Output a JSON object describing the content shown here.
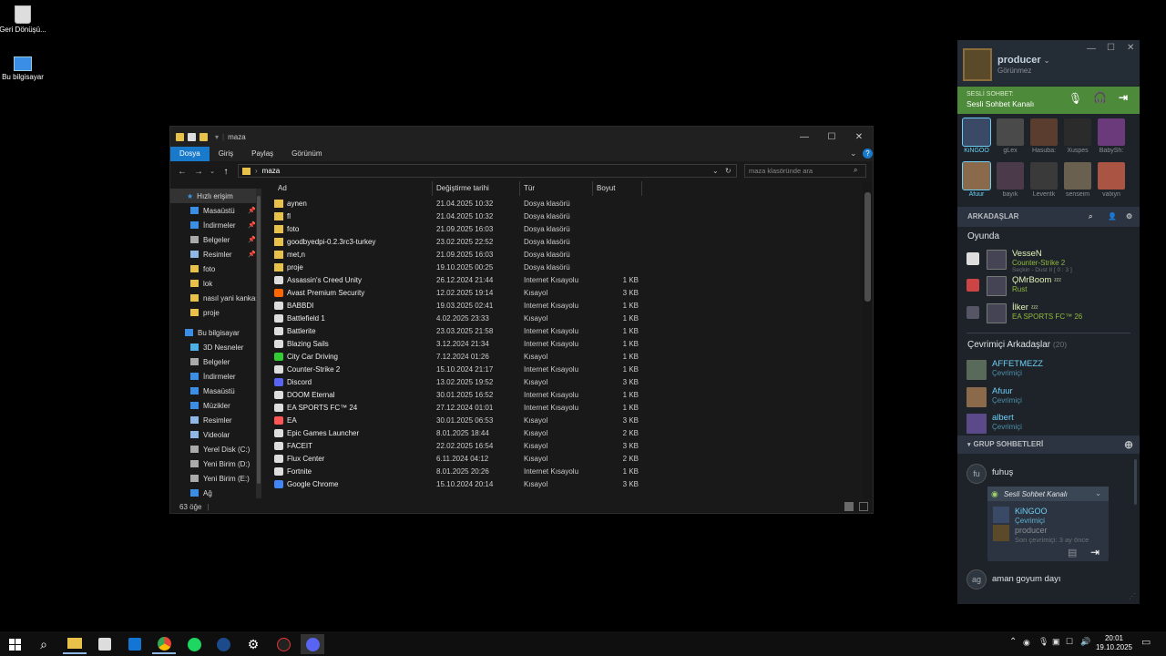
{
  "desktop": {
    "icons": [
      {
        "label": "Geri Dönüşü..."
      },
      {
        "label": "Bu bilgisayar"
      }
    ]
  },
  "explorer": {
    "title": "maza",
    "ribbon_tabs": [
      "Dosya",
      "Giriş",
      "Paylaş",
      "Görünüm"
    ],
    "address_path": "maza",
    "search_placeholder": "maza klasöründe ara",
    "nav": {
      "quick_access": "Hızlı erişim",
      "quick_items": [
        "Masaüstü",
        "İndirmeler",
        "Belgeler",
        "Resimler",
        "foto",
        "lok",
        "nasıl yani kankas",
        "proje"
      ],
      "this_pc": "Bu bilgisayar",
      "pc_items": [
        "3D Nesneler",
        "Belgeler",
        "İndirmeler",
        "Masaüstü",
        "Müzikler",
        "Resimler",
        "Videolar",
        "Yerel Disk (C:)",
        "Yeni Birim (D:)",
        "Yeni Birim (E:)",
        "Ağ"
      ]
    },
    "columns": {
      "name": "Ad",
      "date": "Değiştirme tarihi",
      "type": "Tür",
      "size": "Boyut"
    },
    "files": [
      {
        "name": "aynen",
        "date": "21.04.2025 10:32",
        "type": "Dosya klasörü",
        "size": "",
        "icon": "folder"
      },
      {
        "name": "fl",
        "date": "21.04.2025 10:32",
        "type": "Dosya klasörü",
        "size": "",
        "icon": "folder"
      },
      {
        "name": "foto",
        "date": "21.09.2025 16:03",
        "type": "Dosya klasörü",
        "size": "",
        "icon": "folder"
      },
      {
        "name": "goodbyedpi-0.2.3rc3-turkey",
        "date": "23.02.2025 22:52",
        "type": "Dosya klasörü",
        "size": "",
        "icon": "folder"
      },
      {
        "name": "met,n",
        "date": "21.09.2025 16:03",
        "type": "Dosya klasörü",
        "size": "",
        "icon": "folder"
      },
      {
        "name": "proje",
        "date": "19.10.2025 00:25",
        "type": "Dosya klasörü",
        "size": "",
        "icon": "folder"
      },
      {
        "name": "Assassin's Creed Unity",
        "date": "26.12.2024 21:44",
        "type": "Internet Kısayolu",
        "size": "1 KB",
        "icon": "shortcut"
      },
      {
        "name": "Avast Premium Security",
        "date": "12.02.2025 19:14",
        "type": "Kısayol",
        "size": "3 KB",
        "icon": "avast"
      },
      {
        "name": "BABBDI",
        "date": "19.03.2025 02:41",
        "type": "Internet Kısayolu",
        "size": "1 KB",
        "icon": "shortcut"
      },
      {
        "name": "Battlefield 1",
        "date": "4.02.2025 23:33",
        "type": "Kısayol",
        "size": "1 KB",
        "icon": "shortcut"
      },
      {
        "name": "Battlerite",
        "date": "23.03.2025 21:58",
        "type": "Internet Kısayolu",
        "size": "1 KB",
        "icon": "shortcut"
      },
      {
        "name": "Blazing Sails",
        "date": "3.12.2024 21:34",
        "type": "Internet Kısayolu",
        "size": "1 KB",
        "icon": "shortcut"
      },
      {
        "name": "City Car Driving",
        "date": "7.12.2024 01:26",
        "type": "Kısayol",
        "size": "1 KB",
        "icon": "green"
      },
      {
        "name": "Counter-Strike 2",
        "date": "15.10.2024 21:17",
        "type": "Internet Kısayolu",
        "size": "1 KB",
        "icon": "shortcut"
      },
      {
        "name": "Discord",
        "date": "13.02.2025 19:52",
        "type": "Kısayol",
        "size": "3 KB",
        "icon": "discord"
      },
      {
        "name": "DOOM Eternal",
        "date": "30.01.2025 16:52",
        "type": "Internet Kısayolu",
        "size": "1 KB",
        "icon": "shortcut"
      },
      {
        "name": "EA SPORTS FC™ 24",
        "date": "27.12.2024 01:01",
        "type": "Internet Kısayolu",
        "size": "1 KB",
        "icon": "shortcut"
      },
      {
        "name": "EA",
        "date": "30.01.2025 06:53",
        "type": "Kısayol",
        "size": "3 KB",
        "icon": "ea"
      },
      {
        "name": "Epic Games Launcher",
        "date": "8.01.2025 18:44",
        "type": "Kısayol",
        "size": "2 KB",
        "icon": "shortcut"
      },
      {
        "name": "FACEIT",
        "date": "22.02.2025 16:54",
        "type": "Kısayol",
        "size": "3 KB",
        "icon": "shortcut"
      },
      {
        "name": "Flux Center",
        "date": "6.11.2024 04:12",
        "type": "Kısayol",
        "size": "2 KB",
        "icon": "shortcut"
      },
      {
        "name": "Fortnite",
        "date": "8.01.2025 20:26",
        "type": "Internet Kısayolu",
        "size": "1 KB",
        "icon": "shortcut"
      },
      {
        "name": "Google Chrome",
        "date": "15.10.2024 20:14",
        "type": "Kısayol",
        "size": "3 KB",
        "icon": "chrome"
      }
    ],
    "status": "63 öğe"
  },
  "steam": {
    "username": "producer",
    "user_status": "Görünmez",
    "voice": {
      "label": "SESLİ SOHBET:",
      "channel": "Sesli Sohbet Kanalı"
    },
    "favorites": [
      {
        "name": "KiNGOO",
        "color": "#3a4a66"
      },
      {
        "name": "gLex",
        "color": "#4a4a4a"
      },
      {
        "name": "Hasuba:",
        "color": "#5a3d2e"
      },
      {
        "name": "Xuspes",
        "color": "#2b2b2b"
      },
      {
        "name": "BabySh:",
        "color": "#6a3a7a"
      },
      {
        "name": "Afuur",
        "color": "#8a6a4a"
      },
      {
        "name": "bayık",
        "color": "#4a3a4a"
      },
      {
        "name": "Leventk",
        "color": "#3a3a3a"
      },
      {
        "name": "senseim",
        "color": "#6a6050"
      },
      {
        "name": "valxyn",
        "color": "#aa5544"
      }
    ],
    "friends_header": "ARKADAŞLAR",
    "ingame_header": "Oyunda",
    "ingame": [
      {
        "name": "VesseN",
        "game": "Counter-Strike 2",
        "detail": "Seçkin - Dust II [ 0 : 3 ]",
        "color": "#ddd"
      },
      {
        "name": "ϘMrBoom",
        "game": "Rust",
        "detail": "",
        "suffix": "ᶻᶻᶻ",
        "color": "#c44"
      },
      {
        "name": "İlker",
        "game": "EA SPORTS FC™ 26",
        "detail": "",
        "suffix": "ᶻᶻᶻ",
        "color": "#556"
      }
    ],
    "online_header": "Çevrimiçi Arkadaşlar",
    "online_count": "(20)",
    "online": [
      {
        "name": "AFFETMEZZ",
        "status": "Çevrimiçi",
        "color": "#5a6a5a"
      },
      {
        "name": "Afuur",
        "status": "Çevrimiçi",
        "color": "#8a6a4a"
      },
      {
        "name": "albert",
        "status": "Çevrimiçi",
        "color": "#5a4a8a"
      }
    ],
    "group_header": "GRUP SOHBETLERİ",
    "groups": [
      {
        "abbr": "fu",
        "name": "fuhuş"
      },
      {
        "abbr": "ag",
        "name": "aman goyum dayı"
      }
    ],
    "popup": {
      "title": "Sesli Sohbet Kanalı",
      "members": [
        {
          "name": "KiNGOO",
          "status": "Çevrimiçi"
        },
        {
          "name": "producer",
          "status": "Son çevrimiçi: 3 ay önce"
        }
      ]
    }
  },
  "taskbar": {
    "time": "20:01",
    "date": "19.10.2025"
  }
}
